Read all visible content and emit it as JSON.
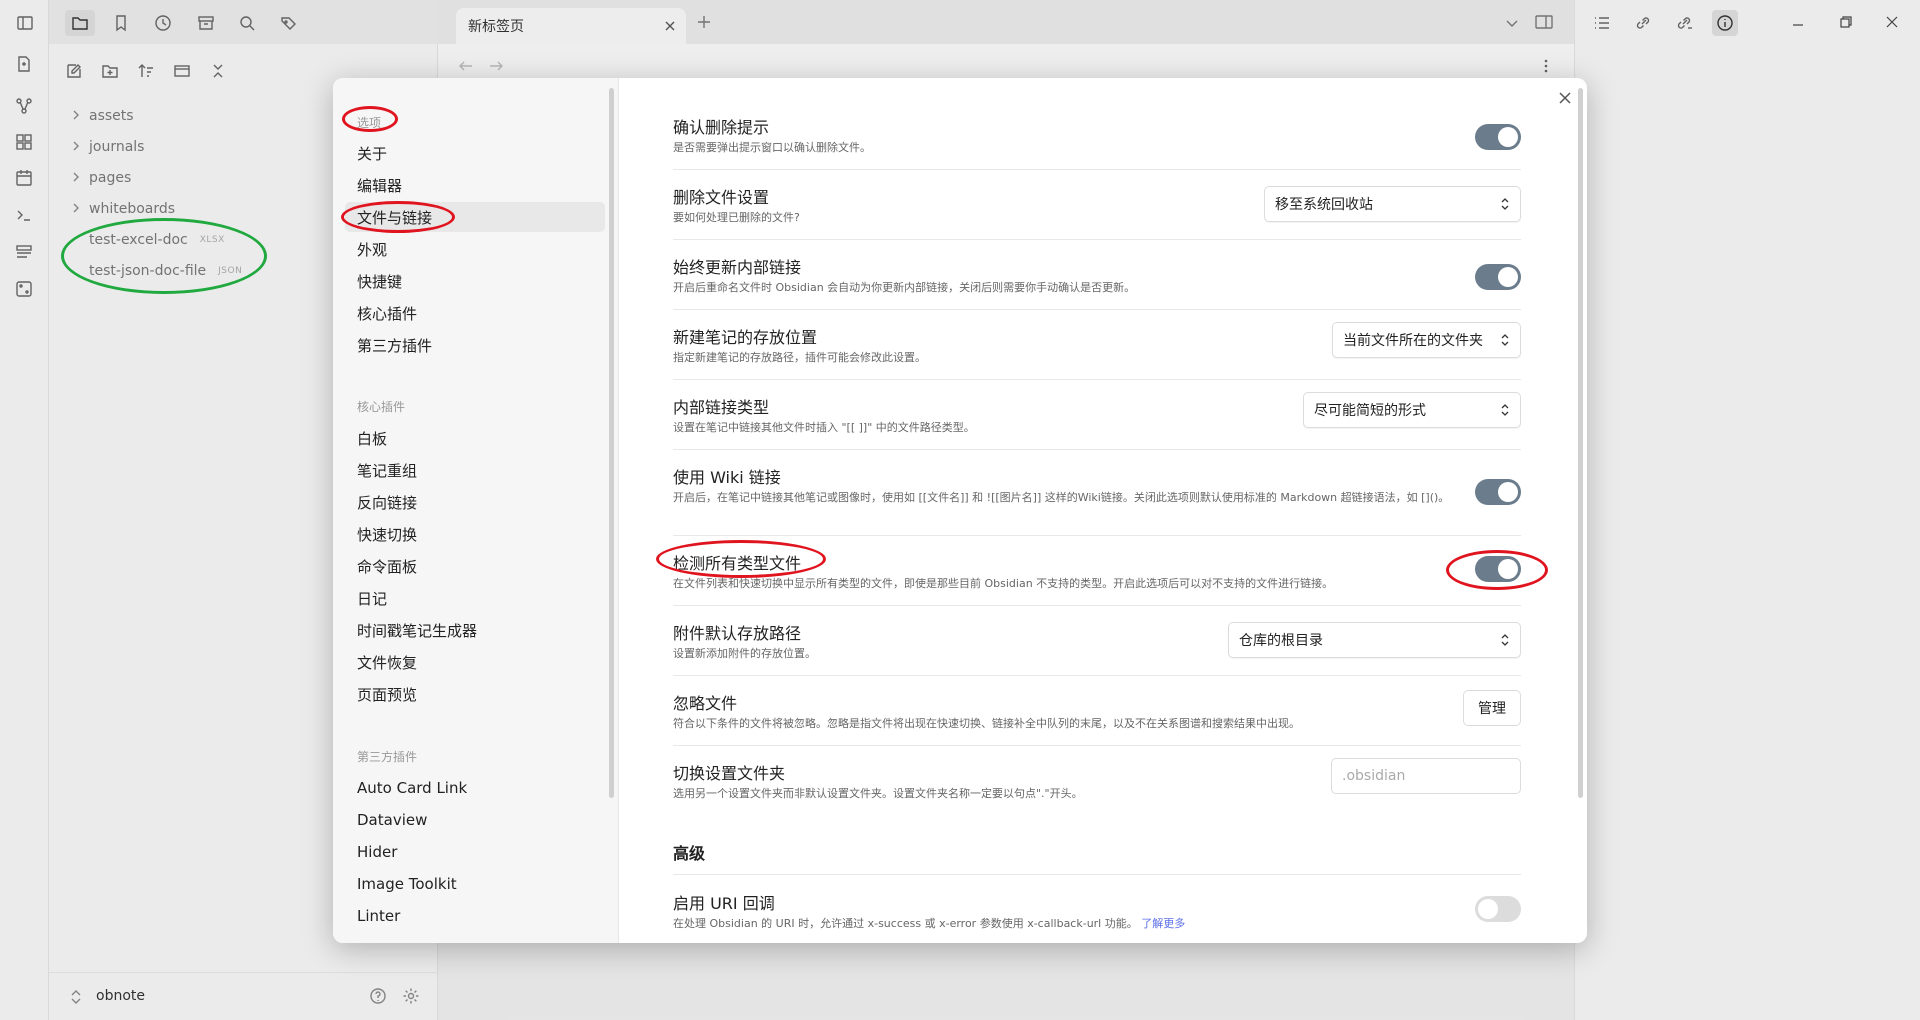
{
  "tab": {
    "title": "新标签页"
  },
  "tree": [
    {
      "label": "assets",
      "type": "folder"
    },
    {
      "label": "journals",
      "type": "folder"
    },
    {
      "label": "pages",
      "type": "folder"
    },
    {
      "label": "whiteboards",
      "type": "folder"
    },
    {
      "label": "test-excel-doc",
      "type": "file",
      "ext": "XLSX"
    },
    {
      "label": "test-json-doc-file",
      "type": "file",
      "ext": "JSON"
    }
  ],
  "vault": {
    "name": "obnote"
  },
  "sidebar": {
    "header_options": "选项",
    "options": [
      "关于",
      "编辑器",
      "文件与链接",
      "外观",
      "快捷键",
      "核心插件",
      "第三方插件"
    ],
    "header_core": "核心插件",
    "core": [
      "白板",
      "笔记重组",
      "反向链接",
      "快速切换",
      "命令面板",
      "日记",
      "时间戳笔记生成器",
      "文件恢复",
      "页面预览"
    ],
    "header_third": "第三方插件",
    "third": [
      "Auto Card Link",
      "Dataview",
      "Hider",
      "Image Toolkit",
      "Linter"
    ]
  },
  "settings": [
    {
      "name": "确认删除提示",
      "desc": "是否需要弹出提示窗口以确认删除文件。",
      "control": "toggle",
      "on": true
    },
    {
      "name": "删除文件设置",
      "desc": "要如何处理已删除的文件?",
      "control": "select",
      "value": "移至系统回收站"
    },
    {
      "name": "始终更新内部链接",
      "desc": "开启后重命名文件时 Obsidian 会自动为你更新内部链接，关闭后则需要你手动确认是否更新。",
      "control": "toggle",
      "on": true
    },
    {
      "name": "新建笔记的存放位置",
      "desc": "指定新建笔记的存放路径，插件可能会修改此设置。",
      "control": "select",
      "value": "当前文件所在的文件夹"
    },
    {
      "name": "内部链接类型",
      "desc": "设置在笔记中链接其他文件时插入 \"[[ ]]\" 中的文件路径类型。",
      "control": "select",
      "value": "尽可能简短的形式"
    },
    {
      "name": "使用 Wiki 链接",
      "desc": "开启后，在笔记中链接其他笔记或图像时，使用如 [[文件名]] 和 ![[图片名]] 这样的Wiki链接。关闭此选项则默认使用标准的 Markdown 超链接语法，如 []()。",
      "control": "toggle",
      "on": true
    },
    {
      "name": "检测所有类型文件",
      "desc": "在文件列表和快速切换中显示所有类型的文件，即使是那些目前 Obsidian 不支持的类型。开启此选项后可以对不支持的文件进行链接。",
      "control": "toggle",
      "on": true
    },
    {
      "name": "附件默认存放路径",
      "desc": "设置新添加附件的存放位置。",
      "control": "select",
      "value": "仓库的根目录"
    },
    {
      "name": "忽略文件",
      "desc": "符合以下条件的文件将被忽略。忽略是指文件将出现在快速切换、链接补全中队列的末尾，以及不在关系图谱和搜索结果中出现。",
      "control": "button",
      "value": "管理"
    },
    {
      "name": "切换设置文件夹",
      "desc": "选用另一个设置文件夹而非默认设置文件夹。设置文件夹名称一定要以句点\".\"开头。",
      "control": "input",
      "placeholder": ".obsidian"
    }
  ],
  "advanced": {
    "title": "高级",
    "name": "启用 URI 回调",
    "desc": "在处理 Obsidian 的 URI 时，允许通过 x-success 或 x-error 参数使用 x-callback-url 功能。",
    "link": "了解更多",
    "on": false
  },
  "colors": {
    "accent_toggle": "#6b7d8c",
    "annotation_red": "#e0141e",
    "annotation_green": "#1fa93f",
    "link": "#5b6ee8"
  }
}
